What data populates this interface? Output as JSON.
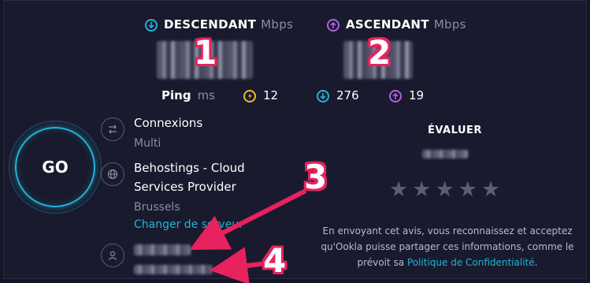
{
  "download": {
    "label": "DESCENDANT",
    "unit": "Mbps",
    "color": "#1fb5d6"
  },
  "upload": {
    "label": "ASCENDANT",
    "unit": "Mbps",
    "color": "#b45ee6"
  },
  "ping": {
    "label": "Ping",
    "unit": "ms",
    "idle": "12",
    "download": "276",
    "upload": "19",
    "idle_color": "#e6c12f"
  },
  "go_button": {
    "label": "GO"
  },
  "connections": {
    "title": "Connexions",
    "value": "Multi"
  },
  "server": {
    "name_line1": "Behostings - Cloud",
    "name_line2": "Services Provider",
    "location": "Brussels",
    "change_link": "Changer de serveur"
  },
  "rating": {
    "title": "ÉVALUER",
    "stars": 5
  },
  "note": {
    "text": "En envoyant cet avis, vous reconnaissez et acceptez qu'Ookla puisse partager ces informations, comme le prévoit sa",
    "link": "Politique de Confidentialité",
    "end": "."
  },
  "annotations": {
    "m1": "1",
    "m2": "2",
    "m3": "3",
    "m4": "4",
    "color": "#e8225e"
  }
}
